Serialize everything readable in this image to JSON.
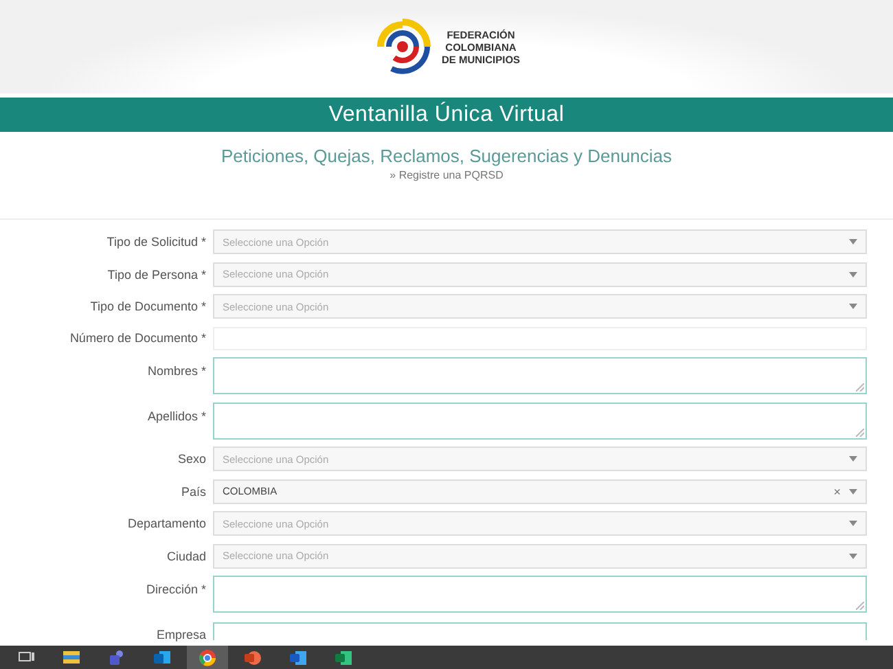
{
  "header": {
    "logo_lines": [
      "FEDERACIÓN",
      "COLOMBIANA",
      "DE MUNICIPIOS"
    ]
  },
  "banner": {
    "title": "Ventanilla Única Virtual"
  },
  "heading": {
    "title": "Peticiones, Quejas, Reclamos, Sugerencias y Denuncias",
    "link": "» Registre una PQRSD"
  },
  "form": {
    "fields": [
      {
        "label": "Tipo de Solicitud *",
        "kind": "select",
        "placeholder": "Seleccione una Opción"
      },
      {
        "label": "Tipo de Persona *",
        "kind": "select",
        "placeholder": "Seleccione una Opción"
      },
      {
        "label": "Tipo de Documento *",
        "kind": "select",
        "placeholder": "Seleccione una Opción"
      },
      {
        "label": "Número de Documento *",
        "kind": "input"
      },
      {
        "label": "Nombres *",
        "kind": "textarea"
      },
      {
        "label": "Apellidos *",
        "kind": "textarea"
      },
      {
        "label": "Sexo",
        "kind": "select",
        "placeholder": "Seleccione una Opción"
      },
      {
        "label": "País",
        "kind": "select",
        "value": "COLOMBIA",
        "clear": "×"
      },
      {
        "label": "Departamento",
        "kind": "select",
        "placeholder": "Seleccione una Opción"
      },
      {
        "label": "Ciudad",
        "kind": "select",
        "placeholder": "Seleccione una Opción"
      },
      {
        "label": "Dirección *",
        "kind": "textarea"
      },
      {
        "label": "Empresa",
        "kind": "textarea",
        "cut_off": true
      }
    ]
  },
  "taskbar": {
    "apps": [
      {
        "kind": "taskview",
        "selected": false
      },
      {
        "kind": "folder",
        "selected": false
      },
      {
        "kind": "people",
        "selected": false
      },
      {
        "kind": "mail",
        "selected": false
      },
      {
        "kind": "browser",
        "selected": true
      },
      {
        "kind": "slides",
        "selected": false
      },
      {
        "kind": "doc",
        "selected": false
      },
      {
        "kind": "sheet",
        "selected": false
      }
    ]
  }
}
